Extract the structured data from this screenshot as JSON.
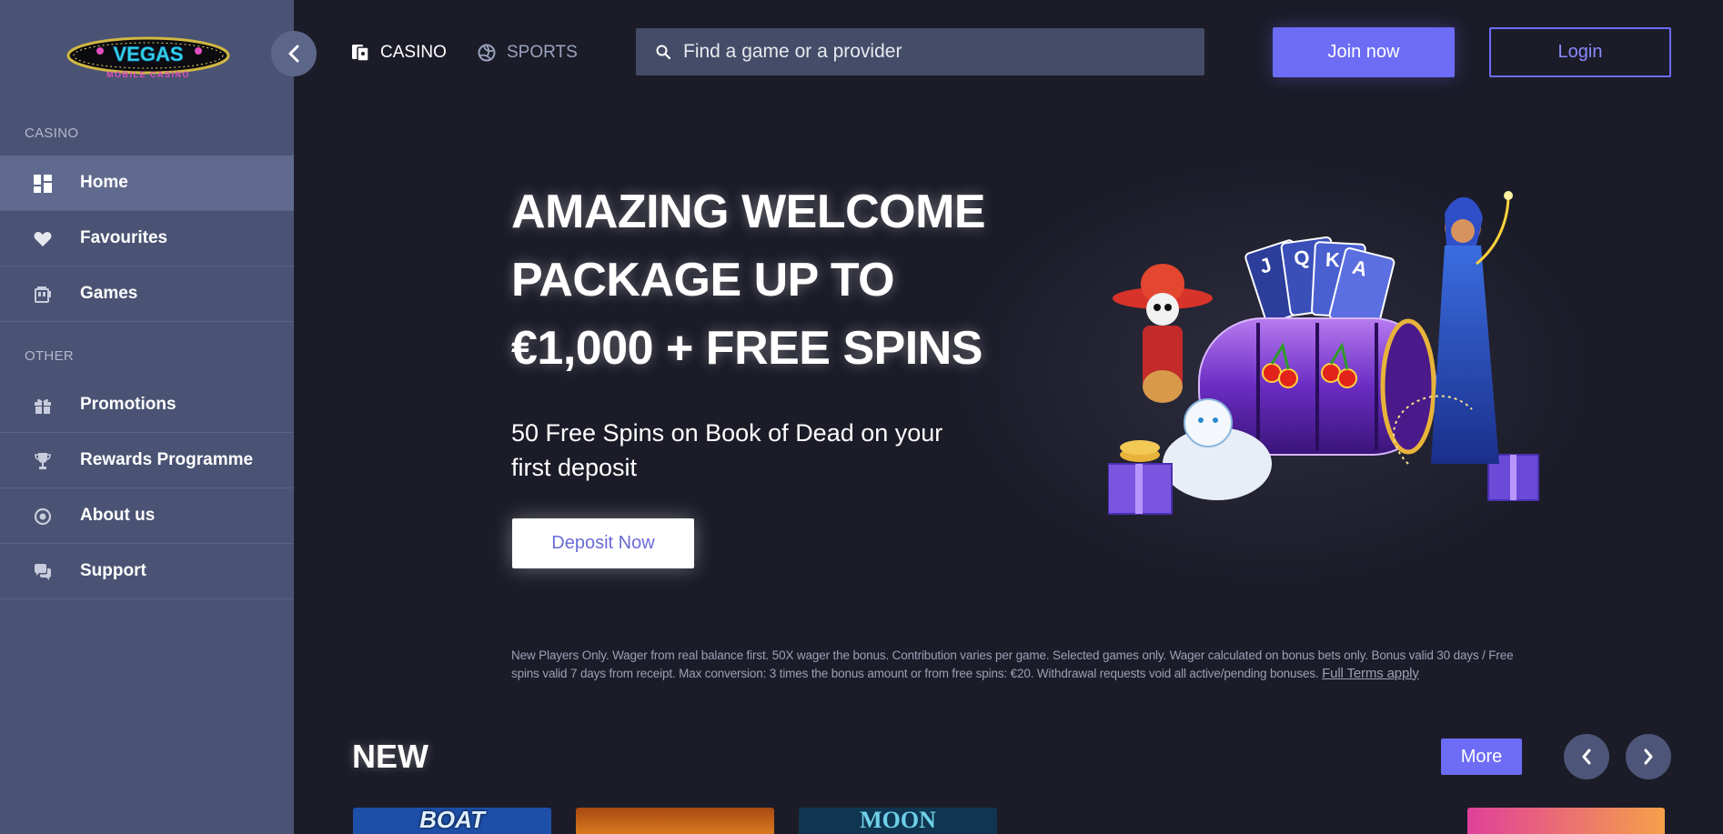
{
  "brand": {
    "logo_top": "VEGAS",
    "logo_bottom": "MOBILE CASINO"
  },
  "sidebar": {
    "sections": [
      {
        "label": "CASINO",
        "items": [
          {
            "label": "Home",
            "icon": "grid-icon",
            "active": true
          },
          {
            "label": "Favourites",
            "icon": "heart-icon"
          },
          {
            "label": "Games",
            "icon": "slot-machine-icon"
          }
        ]
      },
      {
        "label": "OTHER",
        "items": [
          {
            "label": "Promotions",
            "icon": "gift-icon"
          },
          {
            "label": "Rewards Programme",
            "icon": "trophy-icon"
          },
          {
            "label": "About us",
            "icon": "target-icon"
          },
          {
            "label": "Support",
            "icon": "chat-icon"
          }
        ]
      }
    ]
  },
  "header": {
    "tabs": [
      {
        "label": "CASINO",
        "icon": "cards-icon",
        "active": true
      },
      {
        "label": "SPORTS",
        "icon": "volleyball-icon",
        "active": false
      }
    ],
    "search_placeholder": "Find a game or a provider",
    "join_label": "Join now",
    "login_label": "Login"
  },
  "hero": {
    "title": "AMAZING WELCOME PACKAGE UP TO €1,000 + FREE SPINS",
    "subtitle": "50 Free Spins on Book of Dead on your first deposit",
    "cta_label": "Deposit Now",
    "terms_text": "New Players Only. Wager from real balance first. 50X wager the bonus. Contribution varies per game. Selected games only. Wager calculated on bonus bets only. Bonus valid 30 days / Free spins valid 7 days from receipt. Max conversion: 3 times the bonus amount or from free spins: €20. Withdrawal requests void all active/pending bonuses.",
    "terms_link": "Full Terms apply",
    "art_card_letters": [
      "J",
      "Q",
      "K",
      "A"
    ]
  },
  "new_section": {
    "title": "NEW",
    "more_label": "More",
    "games": [
      {
        "text": "BOAT",
        "bg": "#1d4fa8"
      },
      {
        "text": "",
        "bg": "#c5661a"
      },
      {
        "text": "MOON",
        "bg": "#0f3550"
      },
      {
        "text": "",
        "bg": "#e0409a"
      }
    ]
  },
  "colors": {
    "accent": "#6c6cf5",
    "sidebar_bg": "#4a5373",
    "page_bg": "#1b1c28"
  }
}
